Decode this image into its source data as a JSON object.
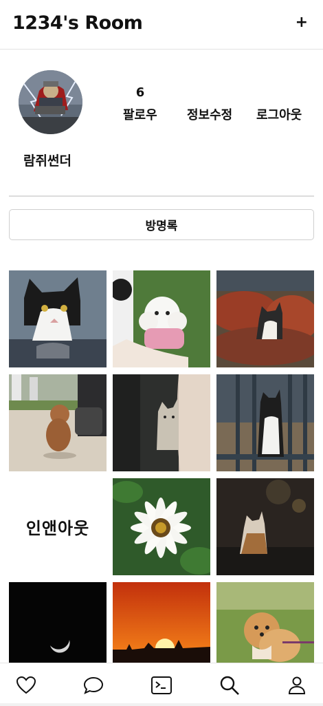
{
  "header": {
    "title": "1234's Room",
    "add_label": "+"
  },
  "profile": {
    "username": "람쥐썬더",
    "follower_count": "6",
    "follower_label": "팔로우",
    "edit_label": "정보수정",
    "logout_label": "로그아웃"
  },
  "guestbook": {
    "label": "방명록"
  },
  "grid": {
    "tiles": [
      {
        "type": "photo",
        "subject": "black-white-cat"
      },
      {
        "type": "photo",
        "subject": "white-poodle"
      },
      {
        "type": "photo",
        "subject": "cat-in-shrubs"
      },
      {
        "type": "photo",
        "subject": "brown-poodle-walking"
      },
      {
        "type": "photo",
        "subject": "cat-behind-curtain"
      },
      {
        "type": "photo",
        "subject": "cat-at-railing"
      },
      {
        "type": "text",
        "label": "인앤아웃"
      },
      {
        "type": "photo",
        "subject": "white-daisy"
      },
      {
        "type": "photo",
        "subject": "cat-night-street"
      },
      {
        "type": "photo",
        "subject": "crescent-moon"
      },
      {
        "type": "photo",
        "subject": "sunset"
      },
      {
        "type": "photo",
        "subject": "pomeranian"
      }
    ]
  },
  "nav": [
    "heart-icon",
    "chat-icon",
    "terminal-icon",
    "search-icon",
    "profile-icon"
  ]
}
